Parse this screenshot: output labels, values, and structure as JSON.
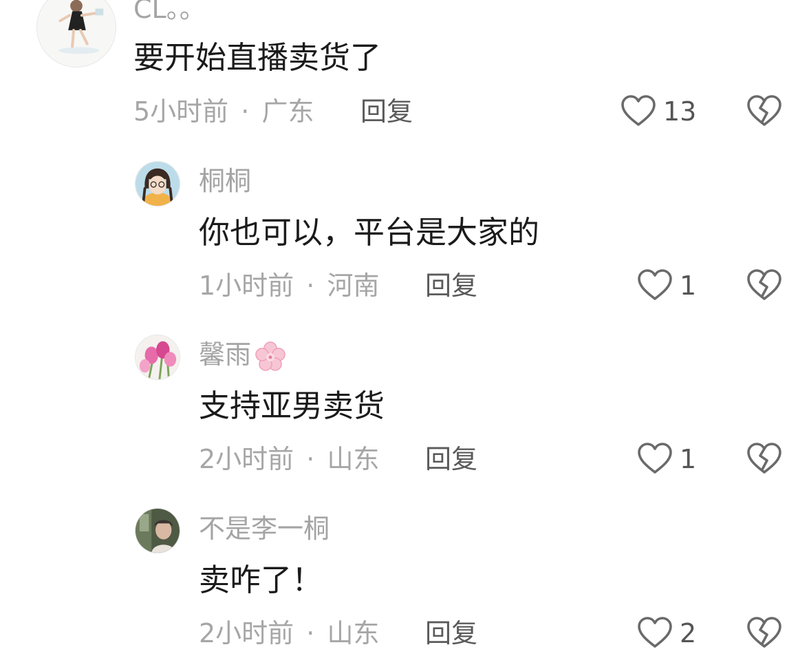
{
  "comments": [
    {
      "username": "CL。。",
      "content": "要开始直播卖货了",
      "time": "5小时前",
      "separator": "·",
      "location": "广东",
      "reply_label": "回复",
      "likes": "13",
      "avatar_icon": "girl-cartoon-avatar"
    },
    {
      "username": "桐桐",
      "content": "你也可以，平台是大家的",
      "time": "1小时前",
      "separator": "·",
      "location": "河南",
      "reply_label": "回复",
      "likes": "1",
      "avatar_icon": "girl-glasses-avatar"
    },
    {
      "username": "馨雨",
      "content": "支持亚男卖货",
      "time": "2小时前",
      "separator": "·",
      "location": "山东",
      "reply_label": "回复",
      "likes": "1",
      "avatar_icon": "tulip-avatar",
      "name_emoji": "cherry-blossom-icon"
    },
    {
      "username": "不是李一桐",
      "content": "卖咋了！",
      "time": "2小时前",
      "separator": "·",
      "location": "山东",
      "reply_label": "回复",
      "likes": "2",
      "avatar_icon": "photo-avatar"
    }
  ],
  "colors": {
    "username": "#a4a4a4",
    "content": "#1b1b1b",
    "meta": "#a6a6a6",
    "reply": "#5a5a5a",
    "icon_stroke": "#6a6a6a"
  }
}
